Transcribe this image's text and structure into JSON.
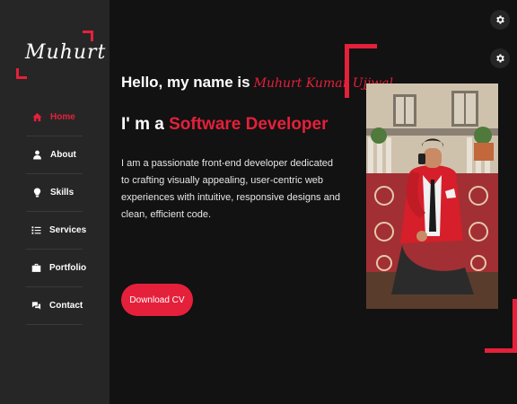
{
  "logo": {
    "text": "Muhurt"
  },
  "nav": [
    {
      "label": "Home",
      "icon": "home-icon",
      "active": true
    },
    {
      "label": "About",
      "icon": "user-icon",
      "active": false
    },
    {
      "label": "Skills",
      "icon": "lightbulb-icon",
      "active": false
    },
    {
      "label": "Services",
      "icon": "list-icon",
      "active": false
    },
    {
      "label": "Portfolio",
      "icon": "briefcase-icon",
      "active": false
    },
    {
      "label": "Contact",
      "icon": "chat-icon",
      "active": false
    }
  ],
  "hero": {
    "greeting": "Hello, my name is",
    "name": "Muhurt Kumar Ujjwal",
    "role_prefix": "I' m a",
    "role": "Software Developer",
    "description": "I am a passionate front-end developer dedicated to crafting visually appealing, user-centric web experiences with intuitive, responsive designs and clean, efficient code.",
    "cta": "Download CV"
  },
  "colors": {
    "accent": "#e5203a",
    "background": "#121212",
    "sidebar": "#262626"
  }
}
